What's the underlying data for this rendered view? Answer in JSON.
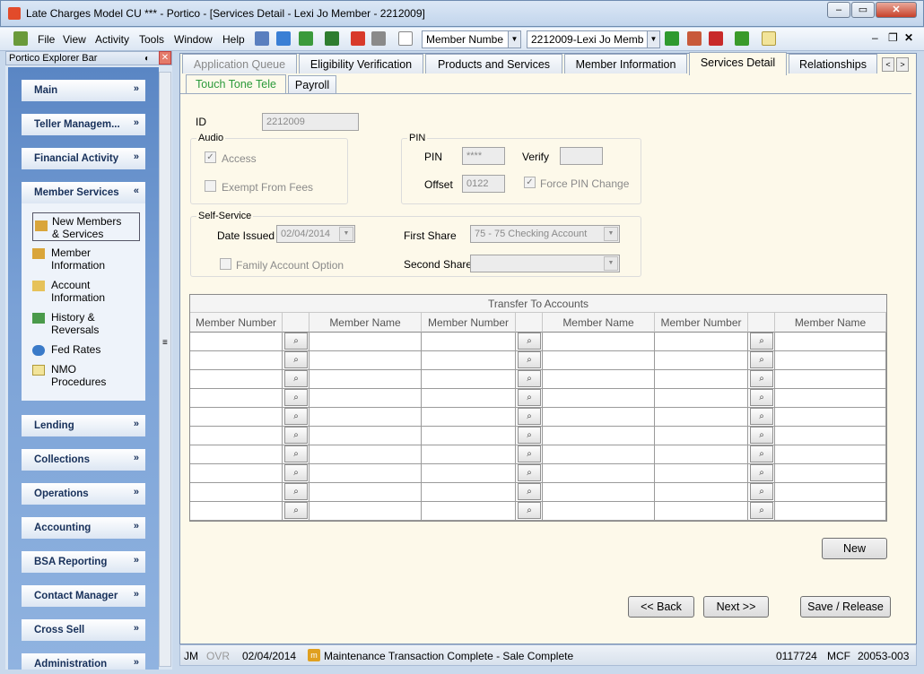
{
  "window": {
    "title": "Late Charges Model CU *** - Portico - [Services Detail - Lexi Jo Member - 2212009]"
  },
  "menu": [
    "File",
    "View",
    "Activity",
    "Tools",
    "Window",
    "Help"
  ],
  "toolbar": {
    "lookup_type": "Member Numbe",
    "member_select": "2212009-Lexi Jo Memb"
  },
  "explorer": {
    "title": "Portico Explorer Bar",
    "groups_top": [
      {
        "label": "Main",
        "chev": "»"
      },
      {
        "label": "Teller Managem...",
        "chev": "»"
      },
      {
        "label": "Financial Activity",
        "chev": "»"
      }
    ],
    "member_services": {
      "label": "Member Services",
      "chev": "«",
      "items": [
        {
          "line1": "New Members",
          "line2": "& Services"
        },
        {
          "line1": "Member",
          "line2": "Information"
        },
        {
          "line1": "Account",
          "line2": "Information"
        },
        {
          "line1": "History &",
          "line2": "Reversals"
        },
        {
          "line1": "Fed Rates",
          "line2": ""
        },
        {
          "line1": "NMO",
          "line2": "Procedures"
        }
      ]
    },
    "groups_bottom": [
      {
        "label": "Lending",
        "chev": "»"
      },
      {
        "label": "Collections",
        "chev": "»"
      },
      {
        "label": "Operations",
        "chev": "»"
      },
      {
        "label": "Accounting",
        "chev": "»"
      },
      {
        "label": "BSA Reporting",
        "chev": "»"
      },
      {
        "label": "Contact Manager",
        "chev": "»"
      },
      {
        "label": "Cross Sell",
        "chev": "»"
      },
      {
        "label": "Administration",
        "chev": "»"
      }
    ]
  },
  "tabs": [
    "Application Queue",
    "Eligibility Verification",
    "Products and Services",
    "Member Information",
    "Services Detail",
    "Relationships"
  ],
  "subtabs": [
    "Touch Tone Tele",
    "Payroll"
  ],
  "form": {
    "id_label": "ID",
    "id_value": "2212009",
    "audio": {
      "title": "Audio",
      "access": "Access",
      "exempt": "Exempt From Fees"
    },
    "pin": {
      "title": "PIN",
      "pin_label": "PIN",
      "pin_value": "****",
      "verify_label": "Verify",
      "offset_label": "Offset",
      "offset_value": "0122",
      "force": "Force PIN Change"
    },
    "self_service": {
      "title": "Self-Service",
      "date_label": "Date Issued",
      "date_value": "02/04/2014",
      "family": "Family Account Option",
      "first_share_label": "First Share",
      "first_share_value": "75 - 75 Checking Account",
      "second_share_label": "Second Share"
    }
  },
  "grid": {
    "title": "Transfer To Accounts",
    "col_number": "Member Number",
    "col_name": "Member Name",
    "rows": 10
  },
  "buttons": {
    "new": "New",
    "back": "<< Back",
    "next": "Next >>",
    "save": "Save / Release"
  },
  "status": {
    "user": "JM",
    "ovr": "OVR",
    "date": "02/04/2014",
    "message": "Maintenance Transaction Complete - Sale Complete",
    "acct": "0117724",
    "mcf": "MCF",
    "code": "20053-003"
  }
}
